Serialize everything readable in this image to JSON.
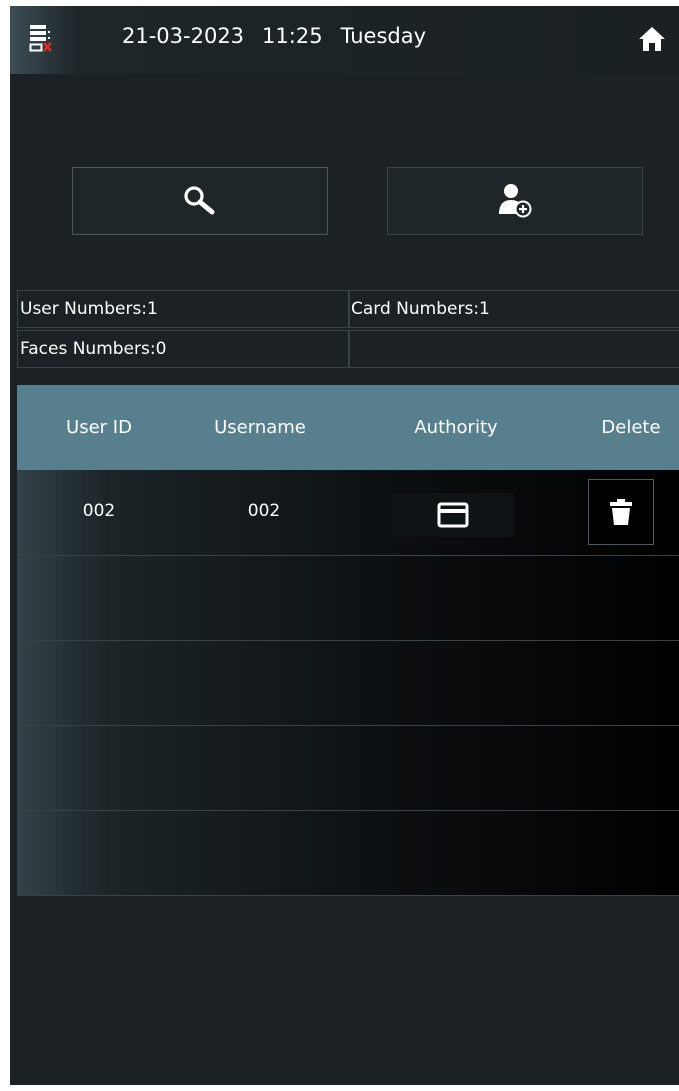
{
  "statusbar": {
    "date": "21-03-2023",
    "time": "11:25",
    "weekday": "Tuesday",
    "network_icon": "network-disconnected-icon",
    "home_icon": "home-icon"
  },
  "actions": {
    "search_icon": "search-icon",
    "add_user_icon": "add-user-icon"
  },
  "stats": {
    "user_numbers": "User Numbers:1",
    "card_numbers": "Card Numbers:1",
    "faces_numbers": "Faces Numbers:0"
  },
  "table": {
    "headers": [
      "User ID",
      "Username",
      "Authority",
      "Delete"
    ],
    "rows": [
      {
        "user_id": "002",
        "username": "002",
        "authority_icon": "card-icon",
        "delete_icon": "trash-icon"
      }
    ]
  },
  "colors": {
    "header_bg": "#587f8e",
    "screen_bg": "#1b2124",
    "alert_red": "#e0302a"
  }
}
